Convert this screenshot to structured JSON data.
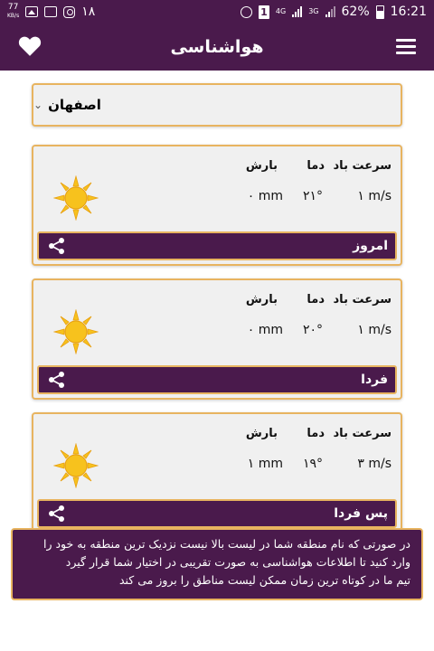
{
  "status_bar": {
    "speed_value": "77",
    "speed_unit": "KB/s",
    "notification_count": "۱۸",
    "sim_label": "1",
    "network_4g": "4G",
    "network_3g": "3G",
    "battery": "62%",
    "time": "16:21"
  },
  "app_bar": {
    "title": "هواشناسی",
    "favorite_icon": "heart-icon",
    "menu_icon": "hamburger-menu-icon"
  },
  "city_select": {
    "selected": "اصفهان"
  },
  "forecast": [
    {
      "day": "امروز",
      "headers": {
        "wind": "سرعت باد",
        "temp": "دما",
        "rain": "بارش"
      },
      "wind": "۱ m/s",
      "temp": "۲۱°",
      "rain": "۰ mm",
      "icon": "sun-icon"
    },
    {
      "day": "فردا",
      "headers": {
        "wind": "سرعت باد",
        "temp": "دما",
        "rain": "بارش"
      },
      "wind": "۱ m/s",
      "temp": "۲۰°",
      "rain": "۰ mm",
      "icon": "sun-icon"
    },
    {
      "day": "پس فردا",
      "headers": {
        "wind": "سرعت باد",
        "temp": "دما",
        "rain": "بارش"
      },
      "wind": "۳ m/s",
      "temp": "۱۹°",
      "rain": "۱ mm",
      "icon": "sun-icon"
    }
  ],
  "notice": {
    "line1": "در صورتی که نام منطقه شما در لیست بالا نیست نزدیک ترین منطقه به خود را",
    "line2": "وارد کنید تا اطلاعات هواشناسی به صورت تقریبی در اختیار شما قرار گیرد",
    "line3": "تیم ما در کوتاه ترین زمان ممکن لیست مناطق را بروز می کند"
  },
  "colors": {
    "primary": "#4a1a4c",
    "accent_border": "#e8b460",
    "card_bg": "#f0f0f0",
    "sun": "#f7c21d"
  }
}
